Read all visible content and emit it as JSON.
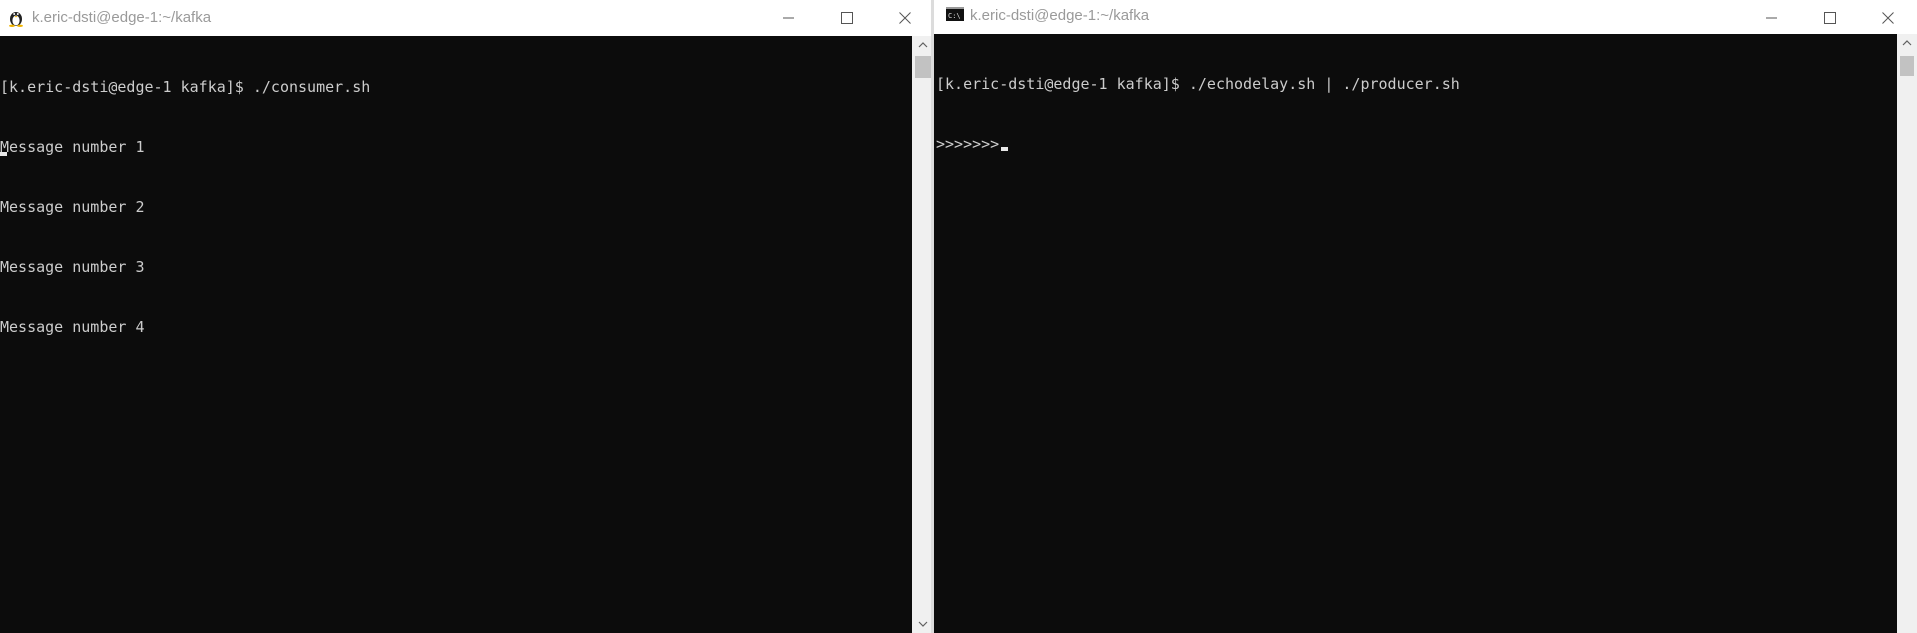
{
  "left_window": {
    "title": "k.eric-dsti@edge-1:~/kafka",
    "icon": "linux-penguin-icon",
    "terminal": {
      "lines": [
        "[k.eric-dsti@edge-1 kafka]$ ./consumer.sh",
        "Message number 1",
        "Message number 2",
        "Message number 3",
        "Message number 4"
      ]
    }
  },
  "right_window": {
    "title": "k.eric-dsti@edge-1:~/kafka",
    "icon": "command-prompt-icon",
    "icon_text": "C:\\",
    "terminal": {
      "lines": [
        "[k.eric-dsti@edge-1 kafka]$ ./echodelay.sh | ./producer.sh",
        ">>>>>>>"
      ]
    }
  },
  "colors": {
    "terminal_bg": "#0c0c0c",
    "terminal_fg": "#cccccc",
    "titlebar_bg": "#ffffff",
    "title_text": "#9a9a9a"
  }
}
